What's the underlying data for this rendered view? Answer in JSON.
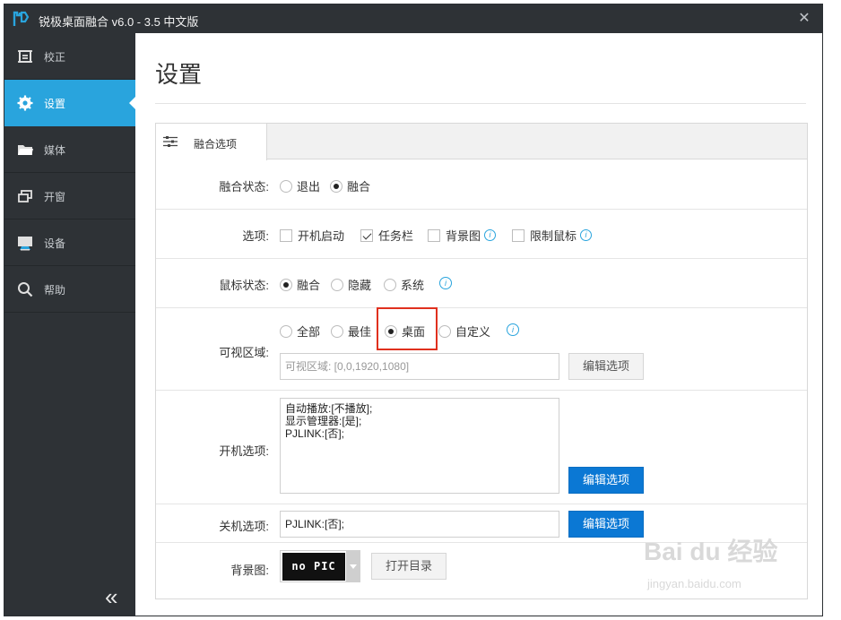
{
  "window": {
    "title": "锐极桌面融合 v6.0 - 3.5 中文版",
    "close_glyph": "✕"
  },
  "sidebar": {
    "items": [
      {
        "label": "校正",
        "icon": "calibrate-icon"
      },
      {
        "label": "设置",
        "icon": "gear-icon",
        "active": true
      },
      {
        "label": "媒体",
        "icon": "folder-icon"
      },
      {
        "label": "开窗",
        "icon": "window-icon"
      },
      {
        "label": "设备",
        "icon": "display-device-icon"
      },
      {
        "label": "帮助",
        "icon": "search-icon"
      }
    ],
    "collapse_glyph": "«"
  },
  "page": {
    "title": "设置"
  },
  "tabs": [
    {
      "label": "融合选项",
      "icon": "sliders-icon"
    }
  ],
  "form": {
    "blend_state": {
      "label": "融合状态:",
      "options": [
        "退出",
        "融合"
      ],
      "selected": "融合"
    },
    "options": {
      "label": "选项:",
      "items": [
        {
          "label": "开机启动",
          "checked": false
        },
        {
          "label": "任务栏",
          "checked": true
        },
        {
          "label": "背景图",
          "checked": false,
          "info": true
        },
        {
          "label": "限制鼠标",
          "checked": false,
          "info": true
        }
      ]
    },
    "mouse_state": {
      "label": "鼠标状态:",
      "options": [
        "融合",
        "隐藏",
        "系统"
      ],
      "selected": "融合"
    },
    "visible_area": {
      "label": "可视区域:",
      "options": [
        "全部",
        "最佳",
        "桌面",
        "自定义"
      ],
      "selected": "桌面",
      "placeholder": "可视区域: [0,0,1920,1080]",
      "button": "编辑选项"
    },
    "boot_options": {
      "label": "开机选项:",
      "lines": [
        "自动播放:[不播放];",
        "显示管理器:[是];",
        "PJLINK:[否];"
      ],
      "button": "编辑选项"
    },
    "shutdown_options": {
      "label": "关机选项:",
      "value": "PJLINK:[否];",
      "button": "编辑选项"
    },
    "background": {
      "label": "背景图:",
      "thumb_text": "no PIC",
      "button": "打开目录"
    }
  },
  "info_glyph": "i",
  "watermark": {
    "main": "Bai du 经验",
    "sub": "jingyan.baidu.com"
  },
  "colors": {
    "sidebar_bg": "#2e3236",
    "accent": "#29a4dd",
    "primary_button": "#0b78d4",
    "highlight": "#e0301e"
  }
}
